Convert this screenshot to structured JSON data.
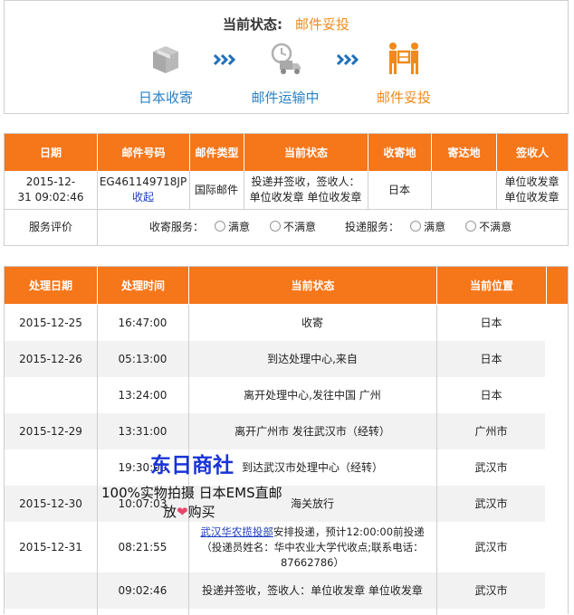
{
  "status": {
    "label": "当前状态:",
    "value": "邮件妥投",
    "steps": [
      {
        "label": "日本收寄",
        "icon": "package-icon"
      },
      {
        "label": "邮件运输中",
        "icon": "delivery-truck-icon"
      },
      {
        "label": "邮件妥投",
        "icon": "courier-handover-icon"
      }
    ],
    "colors": {
      "active": "#f08a1a",
      "inactive": "#2a82c6",
      "header": "#f6761a"
    }
  },
  "mail_table": {
    "headers": [
      "日期",
      "邮件号码",
      "邮件类型",
      "当前状态",
      "收寄地",
      "寄达地",
      "签收人"
    ],
    "row": {
      "date_line1": "2015-12-",
      "date_line2": "31 09:02:46",
      "mail_number": "EG461149718JP",
      "collapse_link": "收起",
      "mail_type": "国际邮件",
      "status_line1": "投递并签收，签收人：",
      "status_line2": "单位收发章 单位收发章",
      "origin": "日本",
      "destination": "",
      "signer_line1": "单位收发章",
      "signer_line2": "单位收发章"
    },
    "rating": {
      "label": "服务评价",
      "collect_label": "收寄服务：",
      "delivery_label": "投递服务：",
      "satisfied": "满意",
      "unsatisfied": "不满意"
    }
  },
  "track_table": {
    "headers": [
      "处理日期",
      "处理时间",
      "当前状态",
      "当前位置"
    ],
    "rows": [
      {
        "date": "2015-12-25",
        "time": "16:47:00",
        "status": "收寄",
        "location": "日本"
      },
      {
        "date": "2015-12-26",
        "time": "05:13:00",
        "status": "到达处理中心,来自",
        "location": "日本"
      },
      {
        "date": "",
        "time": "13:24:00",
        "status": "离开处理中心,发往中国 广州",
        "location": "日本"
      },
      {
        "date": "2015-12-29",
        "time": "13:31:00",
        "status": "离开广州市 发往武汉市（经转）",
        "location": "广州市"
      },
      {
        "date": "",
        "time": "19:30:00",
        "status": "到达武汉市处理中心（经转）",
        "location": "武汉市"
      },
      {
        "date": "2015-12-30",
        "time": "10:07:03",
        "status": "海关放行",
        "location": "武汉市"
      },
      {
        "date": "2015-12-31",
        "time": "08:21:55",
        "status_link": "武汉华农揽投部",
        "status_rest": "安排投递，预计12:00:00前投递",
        "status_line2": "（投递员姓名：华中农业大学代收点;联系电话：",
        "status_line3": "87662786）",
        "location": "武汉市"
      },
      {
        "date": "",
        "time": "09:02:46",
        "status": "投递并签收，签收人：单位收发章 单位收发章",
        "location": "武汉市"
      }
    ]
  },
  "watermark": {
    "title": "东日商社",
    "line1": "100%实物拍摄 日本EMS直邮",
    "line2a": "放",
    "line2b": "购买"
  }
}
